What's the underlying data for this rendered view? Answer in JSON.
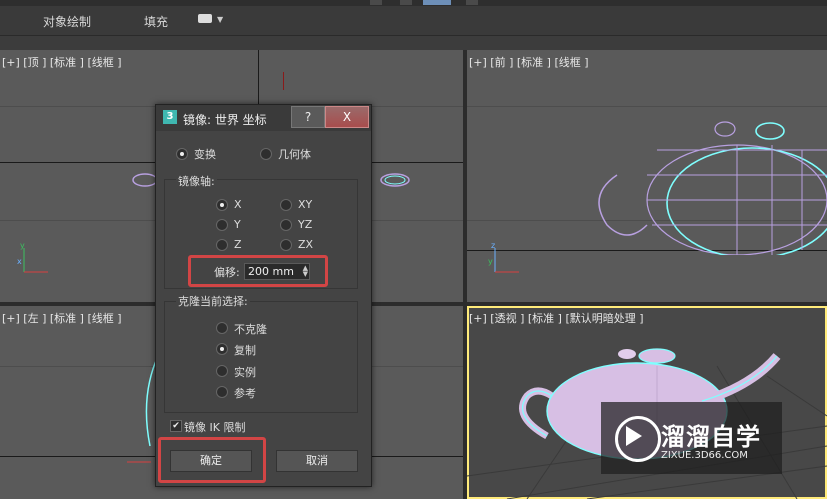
{
  "toolbar": {
    "object_paint_label": "对象绘制",
    "fill_label": "填充"
  },
  "viewports": {
    "top": {
      "label": "[+] [顶 ] [标准 ] [线框 ]"
    },
    "front": {
      "label": "[+] [前 ] [标准 ] [线框 ]"
    },
    "left": {
      "label": "[+] [左 ] [标准 ] [线框 ]"
    },
    "perspective": {
      "label": "[+] [透视 ] [标准 ] [默认明暗处理 ]"
    }
  },
  "axes": {
    "x": "x",
    "y": "y",
    "z": "z"
  },
  "dialog": {
    "app_icon_text": "3",
    "title": "镜像: 世界 坐标",
    "help_label": "?",
    "close_label": "X",
    "mode": {
      "transform": "变换",
      "geometry": "几何体",
      "selected": "transform"
    },
    "mirror_axis_title": "镜像轴:",
    "axes": {
      "x": "X",
      "y": "Y",
      "z": "Z",
      "xy": "XY",
      "yz": "YZ",
      "zx": "ZX",
      "selected": "X"
    },
    "offset_label": "偏移:",
    "offset_value": "200 mm",
    "clone_title": "克隆当前选择:",
    "clone_options": {
      "none": "不克隆",
      "copy": "复制",
      "instance": "实例",
      "reference": "参考",
      "selected": "copy"
    },
    "ik_label": "镜像 IK 限制",
    "ik_checked": true,
    "ok_label": "确定",
    "cancel_label": "取消"
  },
  "watermark": {
    "brand": "溜溜自学",
    "url": "ZIXUE.3D66.COM"
  },
  "colors": {
    "highlight": "#d24545",
    "selected_viewport_border": "#ffeb7a",
    "wire_purple": "#b8a0e0",
    "wire_cyan": "#7fffff",
    "teapot_shaded": "#d7bfe4"
  }
}
